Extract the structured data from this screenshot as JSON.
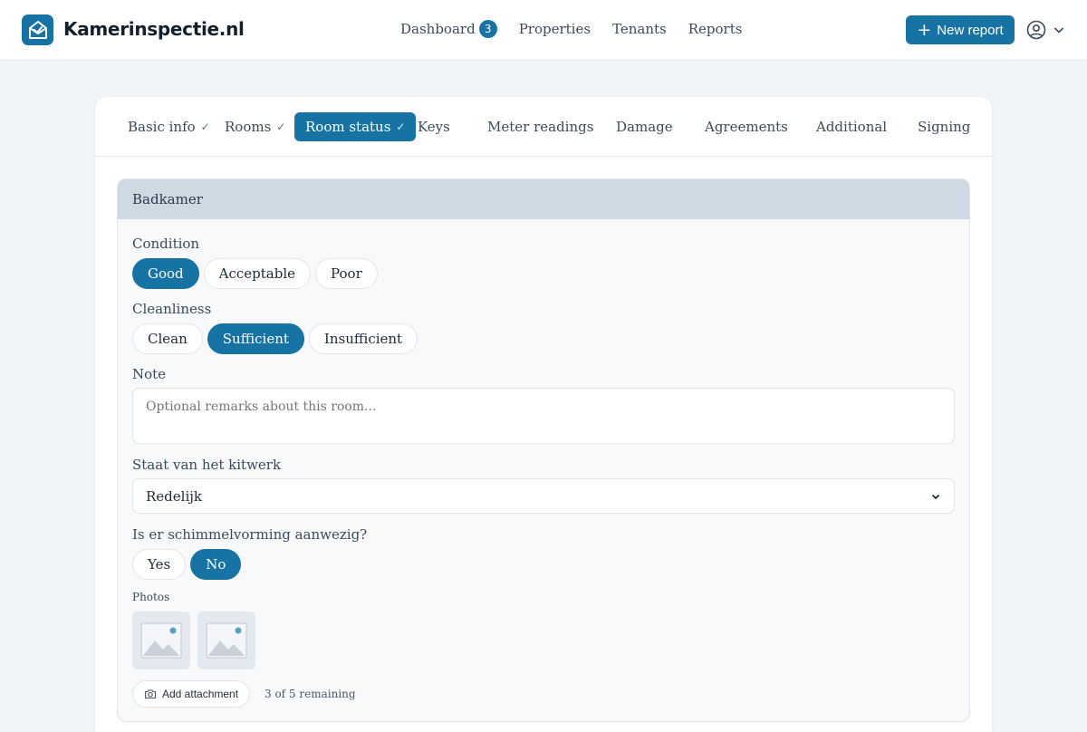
{
  "app": {
    "brand": "Kamerinspectie.nl"
  },
  "nav": {
    "dashboard": "Dashboard",
    "dashboard_badge": "3",
    "properties": "Properties",
    "tenants": "Tenants",
    "reports": "Reports"
  },
  "header": {
    "new_report": "New report"
  },
  "steps": [
    {
      "label": "Basic info",
      "check": "✓"
    },
    {
      "label": "Rooms",
      "check": "✓"
    },
    {
      "label": "Room status",
      "check": "✓",
      "active": true
    },
    {
      "label": "Keys"
    },
    {
      "label": "Meter readings"
    },
    {
      "label": "Damage"
    },
    {
      "label": "Agreements"
    },
    {
      "label": "Additional"
    },
    {
      "label": "Signing"
    }
  ],
  "room": {
    "title": "Badkamer",
    "condition": {
      "label": "Condition",
      "options": [
        "Good",
        "Acceptable",
        "Poor"
      ],
      "selected": "Good"
    },
    "cleanliness": {
      "label": "Cleanliness",
      "options": [
        "Clean",
        "Sufficient",
        "Insufficient"
      ],
      "selected": "Sufficient"
    },
    "note": {
      "label": "Note",
      "placeholder": "Optional remarks about this room..."
    },
    "kitwerk": {
      "label": "Staat van het kitwerk",
      "value": "Redelijk"
    },
    "mold": {
      "label": "Is er schimmelvorming aanwezig?",
      "options": [
        "Yes",
        "No"
      ],
      "selected": "No"
    },
    "photos": {
      "label": "Photos",
      "count": 2
    },
    "attach_label": "Add attachment",
    "remaining": "3 of 5 remaining"
  },
  "colors": {
    "primary": "#1673a3",
    "room_header": "#cfd9e4",
    "page_bg": "#f1f4f8"
  }
}
